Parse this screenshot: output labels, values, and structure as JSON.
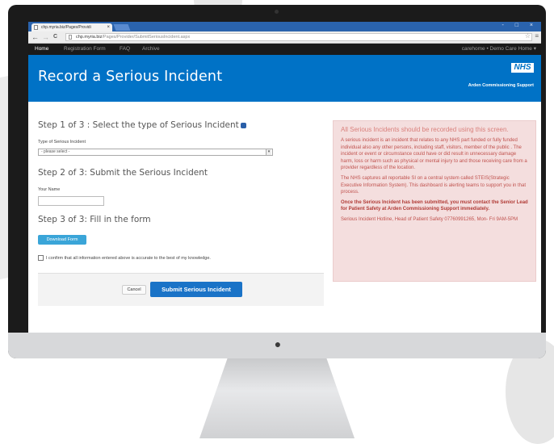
{
  "browser": {
    "tab_title": "chp.myria.biz/Pages/Providi",
    "tab_close": "×",
    "window_controls": "- □ ×",
    "url_host": "chp.myria.biz",
    "url_path": "/Pages/Provider/SubmitSeriousIncident.aspx",
    "back": "←",
    "forward": "→",
    "reload": "C",
    "star": "☆",
    "menu": "≡"
  },
  "nav": {
    "items": [
      "Home",
      "Registration Form",
      "FAQ",
      "Archive"
    ],
    "active": "Home",
    "user": "carehome • Demo Care Home ▾"
  },
  "header": {
    "title": "Record a Serious Incident",
    "logo": "NHS",
    "subtitle": "Arden Commissioning Support"
  },
  "form": {
    "step1_title": "Step 1 of 3 : Select the type of Serious Incident",
    "type_label": "Type of Serious Incident",
    "type_value": "- please select -",
    "step2_title": "Step 2 of 3: Submit the Serious Incident",
    "name_label": "Your Name",
    "name_value": "",
    "step3_title": "Step 3 of 3: Fill in the form",
    "download_label": "Download Form",
    "confirm_label": "I confirm that all information entered above is accurate to the best of my knowledge.",
    "cancel_label": "Cancel",
    "submit_label": "Submit Serious Incident"
  },
  "alert": {
    "title": "All Serious Incidents should be recorded using this screen.",
    "p1": "A serious incident is an incident that relates to any NHS part funded or fully funded individual also any other persons, including staff, visitors, member of the public . The incident or event or circumstance could have or did result in unnecessary damage harm, loss or harm such as physical or mental injury to and those receiving care from a provider regardless of the location.",
    "p2": "The NHS captures all reportable SI on a central system called STEIS(Strategic Executive Information System). This dashboard is alerting teams to support you in that process.",
    "p3": "Once the Serious Incident has been submitted, you must contact the Senior Lead for Patient Safety at Arden Commissioning Support immediately.",
    "p4": "Serious Incident Hotline, Head of Patient Safety 07760991265, Mon- Fri 9AM-5PM"
  },
  "colors": {
    "header_blue": "#0072c6",
    "nav_bg": "#1a1a1a",
    "alert_bg": "#f4dede",
    "alert_text": "#c0524e",
    "submit_blue": "#1a73c7",
    "download_blue": "#3aa5d8"
  }
}
